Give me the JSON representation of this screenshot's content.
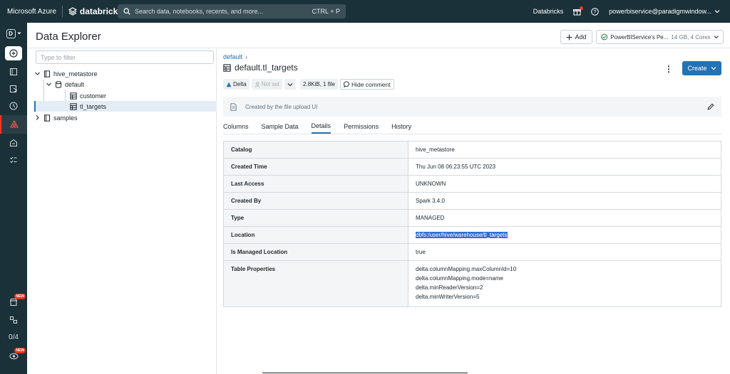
{
  "topbar": {
    "brand": "Microsoft Azure",
    "product": "databricks",
    "search_placeholder": "Search data, notebooks, recents, and more...",
    "search_shortcut": "CTRL + P",
    "workspace": "Databricks",
    "user": "powerbiservice@paradigmwindow..."
  },
  "rail": {
    "workspace_letter": "D",
    "counter": "0/4",
    "new_badge": "NEW"
  },
  "header": {
    "title": "Data Explorer",
    "add_label": "Add",
    "cluster_name": "PowerBIService's Pe...",
    "cluster_meta": "14 GB, 4 Cores"
  },
  "tree": {
    "filter_placeholder": "Type to filter",
    "items": [
      {
        "label": "hive_metastore"
      },
      {
        "label": "default"
      },
      {
        "label": "customer"
      },
      {
        "label": "tl_targets"
      },
      {
        "label": "samples"
      }
    ]
  },
  "main": {
    "breadcrumb": "default",
    "table_title": "default.tl_targets",
    "create_label": "Create",
    "format_chip": "Delta",
    "owner_chip": "Not set",
    "size_chip": "2.8KiB, 1 file",
    "hide_comment_label": "Hide comment",
    "comment": "Created by the file upload UI",
    "tabs": [
      "Columns",
      "Sample Data",
      "Details",
      "Permissions",
      "History"
    ],
    "active_tab": "Details"
  },
  "details": {
    "rows": [
      {
        "key": "Catalog",
        "value": "hive_metastore"
      },
      {
        "key": "Created Time",
        "value": "Thu Jun 08 06:23:55 UTC 2023"
      },
      {
        "key": "Last Access",
        "value": "UNKNOWN"
      },
      {
        "key": "Created By",
        "value": "Spark 3.4.0"
      },
      {
        "key": "Type",
        "value": "MANAGED"
      },
      {
        "key": "Location",
        "value": "dbfs:/user/hive/warehouse/tl_targets"
      },
      {
        "key": "Is Managed Location",
        "value": "true"
      }
    ],
    "properties_key": "Table Properties",
    "properties": [
      "delta.columnMapping.maxColumnId=10",
      "delta.columnMapping.mode=name",
      "delta.minReaderVersion=2",
      "delta.minWriterVersion=5"
    ]
  },
  "colors": {
    "topbar_bg": "#1b3139",
    "accent_blue": "#2272b4",
    "accent_red": "#ff3621",
    "selection_highlight": "#2f6fd6"
  }
}
